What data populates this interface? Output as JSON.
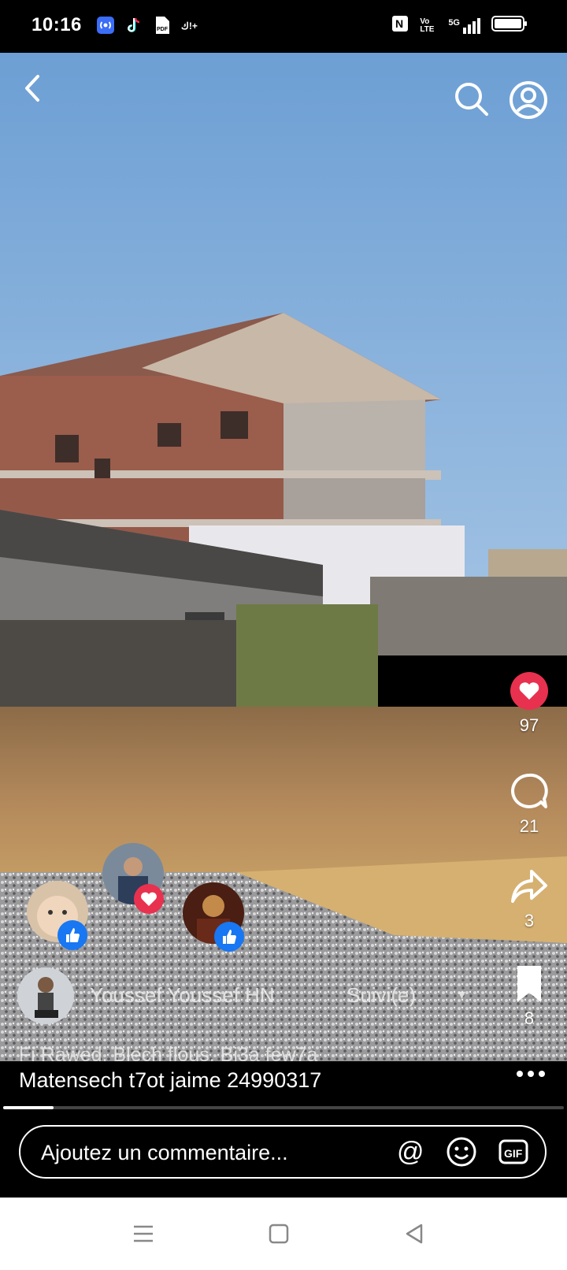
{
  "status_bar": {
    "time": "10:16",
    "left_icons": [
      "hotspot-icon",
      "tiktok-icon",
      "pdf-icon",
      "signal-extra-icon"
    ],
    "right_icons": [
      "nfc-icon",
      "volte-icon",
      "5g-signal-icon",
      "battery-icon"
    ],
    "volte_label": "Vo\nLTE",
    "net_label": "5G"
  },
  "top_controls": {
    "icons": [
      "back-icon",
      "search-icon",
      "profile-icon"
    ]
  },
  "reactions": {
    "likes": "97",
    "comments": "21",
    "shares": "3",
    "saves": "8"
  },
  "post": {
    "author": "Youssef Youssef HN",
    "follow_status": "Suivi(e)",
    "caption_line1": "Fi Rawed. Blech flous. Bi3a few7a",
    "caption_line2": "Matensech t7ot jaime 24990317",
    "progress": 0.09
  },
  "comment": {
    "placeholder": "Ajoutez un commentaire...",
    "mention_symbol": "@",
    "gif_label": "GIF"
  },
  "colors": {
    "accent_red": "#e8314f",
    "like_blue": "#1877f2"
  }
}
